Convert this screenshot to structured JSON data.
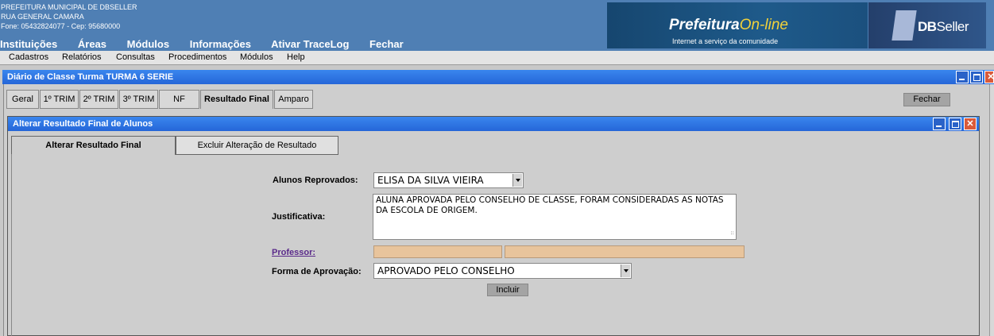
{
  "header": {
    "org_name": "PREFEITURA MUNICIPAL DE DBSELLER",
    "address": "RUA GENERAL CAMARA",
    "contact": "Fone: 05432824077  -  Cep: 95680000",
    "nav": [
      "Instituições",
      "Áreas",
      "Módulos",
      "Informações",
      "Ativar TraceLog",
      "Fechar"
    ],
    "brand_title": "Prefeitura",
    "brand_title_accent": "On-line",
    "brand_subtitle": "Internet a serviço da comunidade",
    "dbseller_bold": "DB",
    "dbseller_rest": "Seller"
  },
  "menu": [
    "Cadastros",
    "Relatórios",
    "Consultas",
    "Procedimentos",
    "Módulos",
    "Help"
  ],
  "window": {
    "title": "Diário de Classe Turma TURMA 6 SERIE",
    "tabs": [
      "Geral",
      "1º TRIM",
      "2º TRIM",
      "3º TRIM",
      "NF",
      "Resultado Final",
      "Amparo"
    ],
    "active_tab": "Resultado Final",
    "close_label": "Fechar"
  },
  "subwindow": {
    "title": "Alterar Resultado Final de Alunos",
    "tabs": [
      "Alterar Resultado Final",
      "Excluir Alteração de Resultado"
    ],
    "form": {
      "reprovados_label": "Alunos Reprovados:",
      "reprovados_value": "ELISA DA SILVA VIEIRA",
      "justificativa_label": "Justificativa:",
      "justificativa_value": "ALUNA APROVADA PELO CONSELHO DE CLASSE, FORAM CONSIDERADAS AS NOTAS DA ESCOLA DE ORIGEM.",
      "professor_label": "Professor:",
      "forma_label": "Forma de Aprovação:",
      "forma_value": "APROVADO PELO CONSELHO",
      "incluir_label": "Incluir"
    }
  },
  "colors": {
    "header_bg": "#4f7fb4",
    "titlebar_blue": "#2566d8",
    "professor_field": "#e8c49c"
  }
}
